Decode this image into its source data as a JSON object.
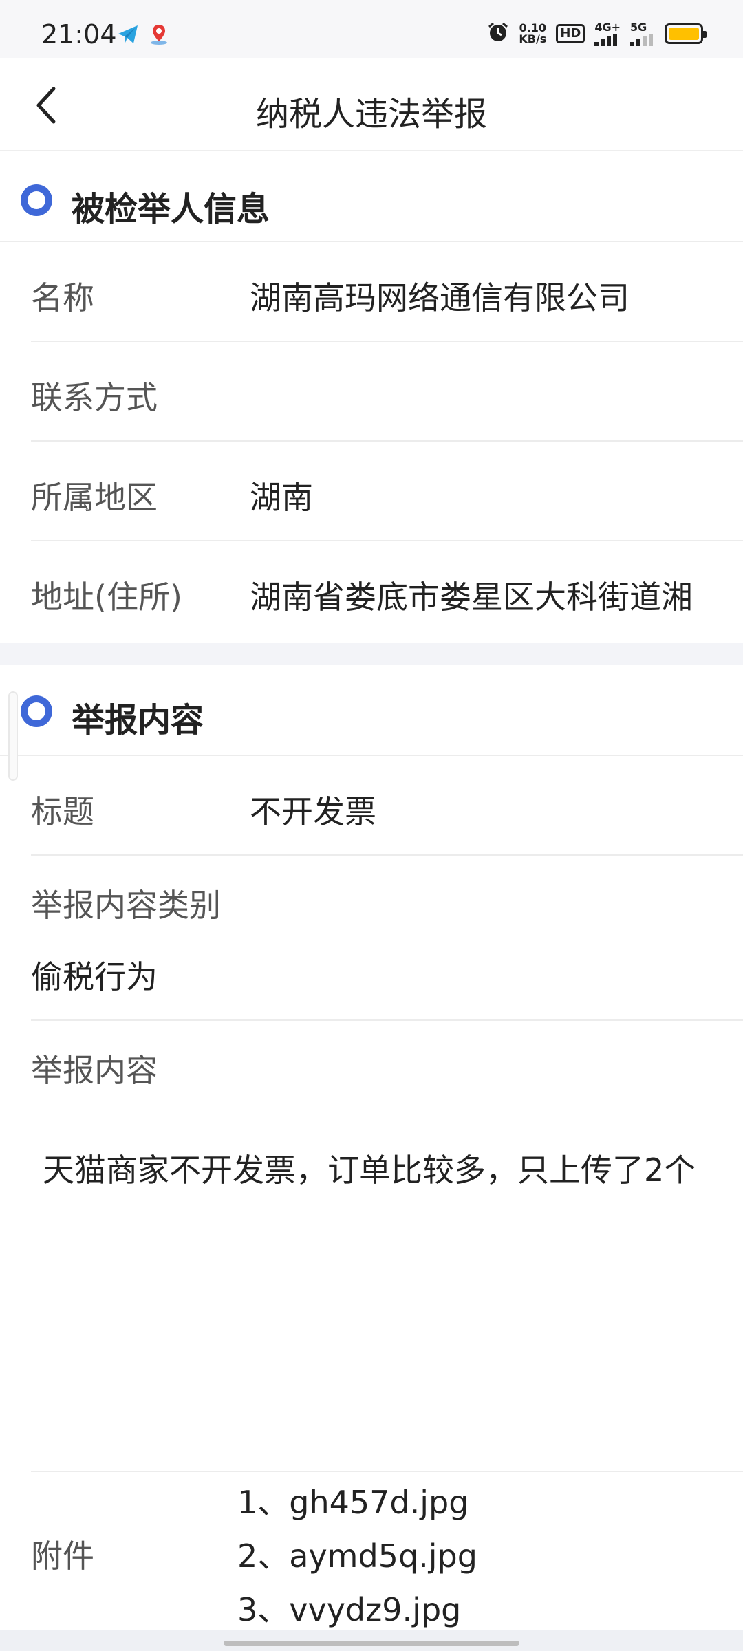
{
  "status_bar": {
    "time": "21:04",
    "speed_value": "0.10",
    "speed_unit": "KB/s",
    "hd": "HD",
    "net1": "4G+",
    "net2": "5G",
    "icons": [
      "telegram-icon",
      "map-pin-icon",
      "alarm-icon",
      "signal-icon",
      "battery-icon"
    ],
    "battery_color": "#ffc000"
  },
  "header": {
    "title": "纳税人违法举报"
  },
  "section1": {
    "title": "被检举人信息",
    "accent": "#3f68d8",
    "rows": [
      {
        "label": "名称",
        "value": "湖南高玛网络通信有限公司"
      },
      {
        "label": "联系方式",
        "value": ""
      },
      {
        "label": "所属地区",
        "value": "湖南"
      },
      {
        "label": "地址(住所)",
        "value": "湖南省娄底市娄星区大科街道湘"
      }
    ]
  },
  "section2": {
    "title": "举报内容",
    "title_row": {
      "label": "标题",
      "value": "不开发票"
    },
    "category": {
      "label": "举报内容类别",
      "value": "偷税行为"
    },
    "content": {
      "label": "举报内容",
      "value": "天猫商家不开发票，订单比较多，只上传了2个"
    },
    "attachments": {
      "label": "附件",
      "items": [
        "1、gh457d.jpg",
        "2、aymd5q.jpg",
        "3、vvydz9.jpg"
      ]
    }
  }
}
